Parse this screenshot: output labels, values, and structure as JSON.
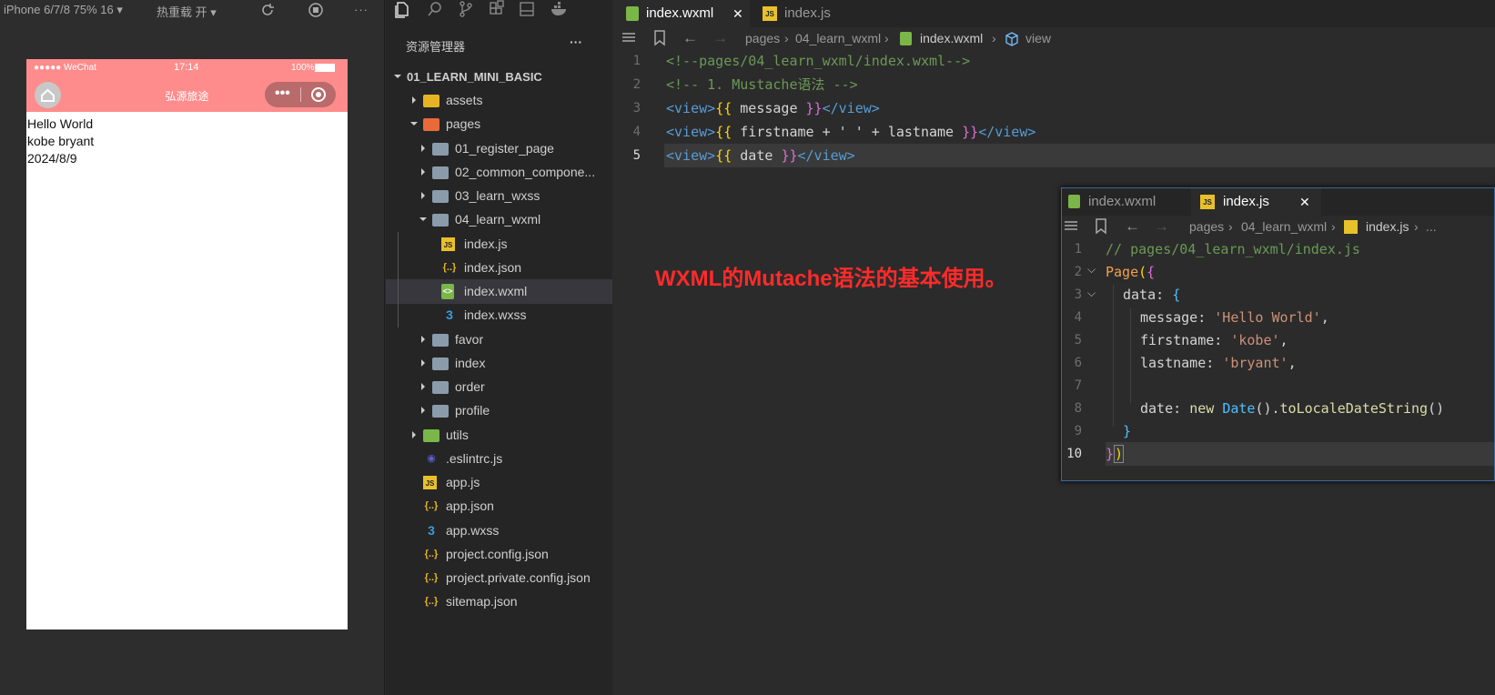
{
  "simulator": {
    "device": "iPhone 6/7/8 75% 16",
    "hot_reload": "热重载 开",
    "status_signal": "●●●●● WeChat",
    "status_time": "17:14",
    "status_battery": "100%",
    "nav_title": "弘源旅途",
    "content_lines": [
      "Hello World",
      "kobe bryant",
      "2024/8/9"
    ]
  },
  "explorer": {
    "title": "资源管理器",
    "more": "···",
    "project": "01_LEARN_MINI_BASIC",
    "items": [
      {
        "label": "assets",
        "icon": "folder-assets-icon",
        "arrow": "right"
      },
      {
        "label": "pages",
        "icon": "folder-pages-icon",
        "arrow": "down"
      },
      {
        "label": "01_register_page",
        "icon": "folder-icon",
        "arrow": "right"
      },
      {
        "label": "02_common_compone...",
        "icon": "folder-icon",
        "arrow": "right"
      },
      {
        "label": "03_learn_wxss",
        "icon": "folder-icon",
        "arrow": "right"
      },
      {
        "label": "04_learn_wxml",
        "icon": "folder-open-icon",
        "arrow": "down"
      },
      {
        "label": "index.js",
        "icon": "js-file-icon"
      },
      {
        "label": "index.json",
        "icon": "json-file-icon"
      },
      {
        "label": "index.wxml",
        "icon": "wxml-file-icon",
        "selected": true
      },
      {
        "label": "index.wxss",
        "icon": "wxss-file-icon"
      },
      {
        "label": "favor",
        "icon": "folder-icon",
        "arrow": "right"
      },
      {
        "label": "index",
        "icon": "folder-icon",
        "arrow": "right"
      },
      {
        "label": "order",
        "icon": "folder-icon",
        "arrow": "right"
      },
      {
        "label": "profile",
        "icon": "folder-icon",
        "arrow": "right"
      },
      {
        "label": "utils",
        "icon": "folder-utils-icon",
        "arrow": "right"
      },
      {
        "label": ".eslintrc.js",
        "icon": "eslint-file-icon"
      },
      {
        "label": "app.js",
        "icon": "js-file-icon"
      },
      {
        "label": "app.json",
        "icon": "json-file-icon"
      },
      {
        "label": "app.wxss",
        "icon": "wxss-file-icon"
      },
      {
        "label": "project.config.json",
        "icon": "json-file-icon"
      },
      {
        "label": "project.private.config.json",
        "icon": "json-file-icon"
      },
      {
        "label": "sitemap.json",
        "icon": "json-file-icon"
      }
    ]
  },
  "editor": {
    "tabs": [
      {
        "label": "index.wxml",
        "active": true
      },
      {
        "label": "index.js",
        "active": false
      }
    ],
    "breadcrumb": [
      "pages",
      "04_learn_wxml",
      "index.wxml",
      "view"
    ],
    "line_numbers": [
      "1",
      "2",
      "3",
      "4",
      "5"
    ],
    "code": {
      "l1": "<!--pages/04_learn_wxml/index.wxml-->",
      "l2": "<!-- 1. Mustache语法 -->",
      "l3_open": "<view>",
      "l3_mo": "{{",
      "l3_body": " message ",
      "l3_mc": "}}",
      "l3_close": "</view>",
      "l4_body": " firstname + ' ' + lastname ",
      "l5_body": " date "
    }
  },
  "overlay": {
    "tabs": [
      {
        "label": "index.wxml",
        "active": false
      },
      {
        "label": "index.js",
        "active": true
      }
    ],
    "breadcrumb": [
      "pages",
      "04_learn_wxml",
      "index.js",
      "..."
    ],
    "line_numbers": [
      "1",
      "2",
      "3",
      "4",
      "5",
      "6",
      "7",
      "8",
      "9",
      "10"
    ],
    "code": {
      "l1": "// pages/04_learn_wxml/index.js",
      "l2_fn": "Page",
      "l3_key": "data",
      "l4_key": "message",
      "l4_val": "'Hello World'",
      "l5_key": "firstname",
      "l5_val": "'kobe'",
      "l6_key": "lastname",
      "l6_val": "'bryant'",
      "l8_key": "date",
      "l8_new": "new",
      "l8_cls": "Date",
      "l8_call": "toLocaleDateString"
    }
  },
  "annotation": "WXML的Mutache语法的基本使用。"
}
